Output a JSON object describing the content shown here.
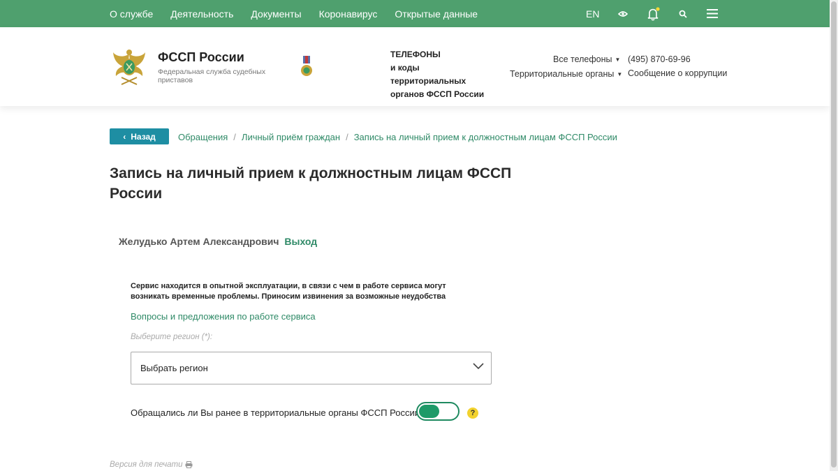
{
  "topnav": {
    "items": [
      "О службе",
      "Деятельность",
      "Документы",
      "Коронавирус",
      "Открытые данные"
    ],
    "lang": "EN"
  },
  "header": {
    "org_name": "ФССП России",
    "org_subtitle": "Федеральная служба судебных приставов",
    "phones_title_1": "ТЕЛЕФОНЫ",
    "phones_title_2": "и коды территориальных органов ФССП России",
    "all_phones": "Все телефоны",
    "territorial": "Территориальные органы",
    "phone": "(495) 870-69-96",
    "corruption": "Сообщение о коррупции"
  },
  "breadcrumb": {
    "back": "Назад",
    "items": [
      "Обращения",
      "Личный приём граждан",
      "Запись на личный прием к должностным лицам ФССП России"
    ]
  },
  "page": {
    "title": "Запись на личный прием к должностным лицам ФССП России",
    "user_name": "Желудько Артем Александрович",
    "logout": "Выход",
    "notice": "Сервис находится в опытной эксплуатации, в связи с чем в работе сервиса могут возникать временные проблемы. Приносим извинения за возможные неудобства",
    "feedback_link": "Вопросы и предложения по работе сервиса",
    "region_label": "Выберите регион (*):",
    "region_select_value": "Выбрать регион",
    "toggle_label": "Обращались ли Вы ранее в территориальные органы ФССП России:",
    "help": "?",
    "print": "Версия для печати"
  },
  "colors": {
    "topbar": "#4fa06e",
    "link": "#2f8a67",
    "back_button": "#1e8ea3",
    "toggle": "#1e9a68",
    "help": "#f2d22e"
  }
}
